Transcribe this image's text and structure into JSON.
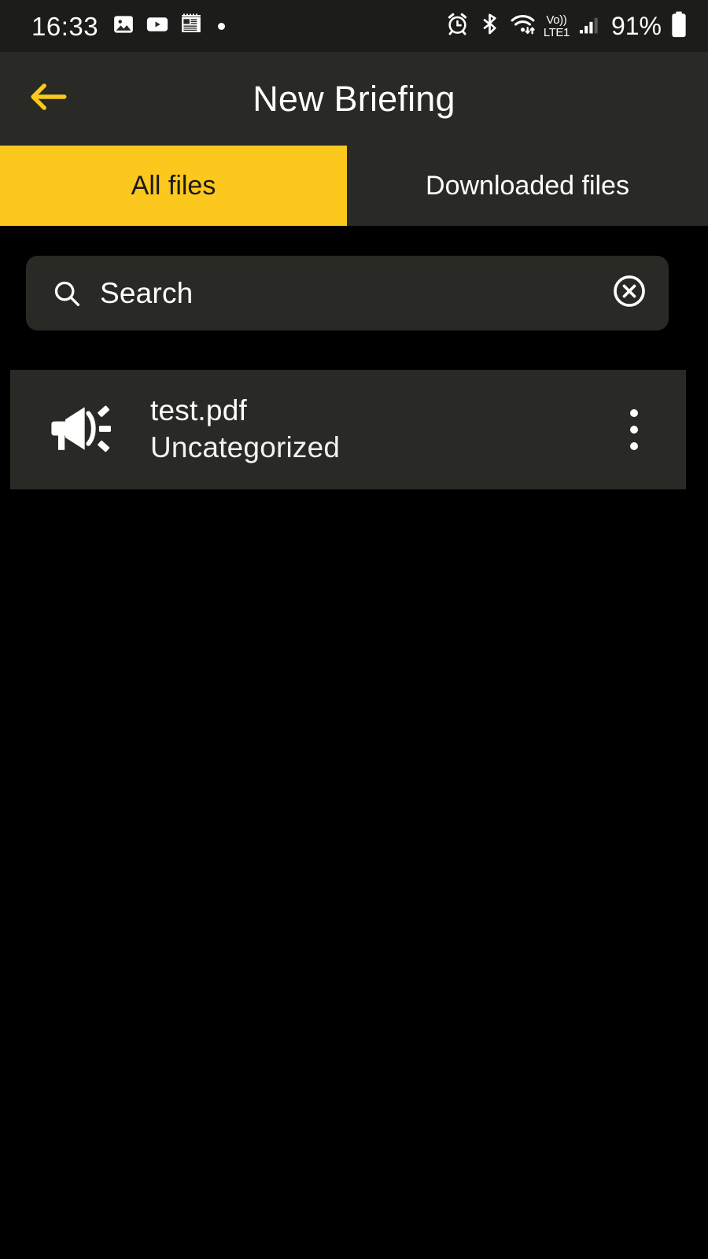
{
  "status_bar": {
    "time": "16:33",
    "left_icons": [
      "gallery-icon",
      "video-play-icon",
      "news-icon",
      "notification-dot"
    ],
    "right_icons": [
      "alarm-icon",
      "bluetooth-icon",
      "wifi-icon",
      "signal-bars-icon",
      "battery-icon"
    ],
    "volte_label_top": "Vo))",
    "volte_label_bottom": "LTE1",
    "battery_percent": "91%"
  },
  "app_bar": {
    "back_icon": "arrow-left-icon",
    "title": "New Briefing"
  },
  "tabs": [
    {
      "label": "All files",
      "active": true
    },
    {
      "label": "Downloaded files",
      "active": false
    }
  ],
  "search": {
    "icon": "search-icon",
    "placeholder": "Search",
    "value": "",
    "clear_icon": "close-circle-icon"
  },
  "files": [
    {
      "icon": "megaphone-icon",
      "name": "test.pdf",
      "category": "Uncategorized",
      "menu_icon": "more-vertical-icon"
    }
  ],
  "colors": {
    "accent_yellow": "#FCC81E",
    "surface": "#292925",
    "status_bar_bg": "#1c1c1a",
    "background": "#000000",
    "text_primary": "#ffffff",
    "text_on_accent": "#1a1a1a"
  }
}
